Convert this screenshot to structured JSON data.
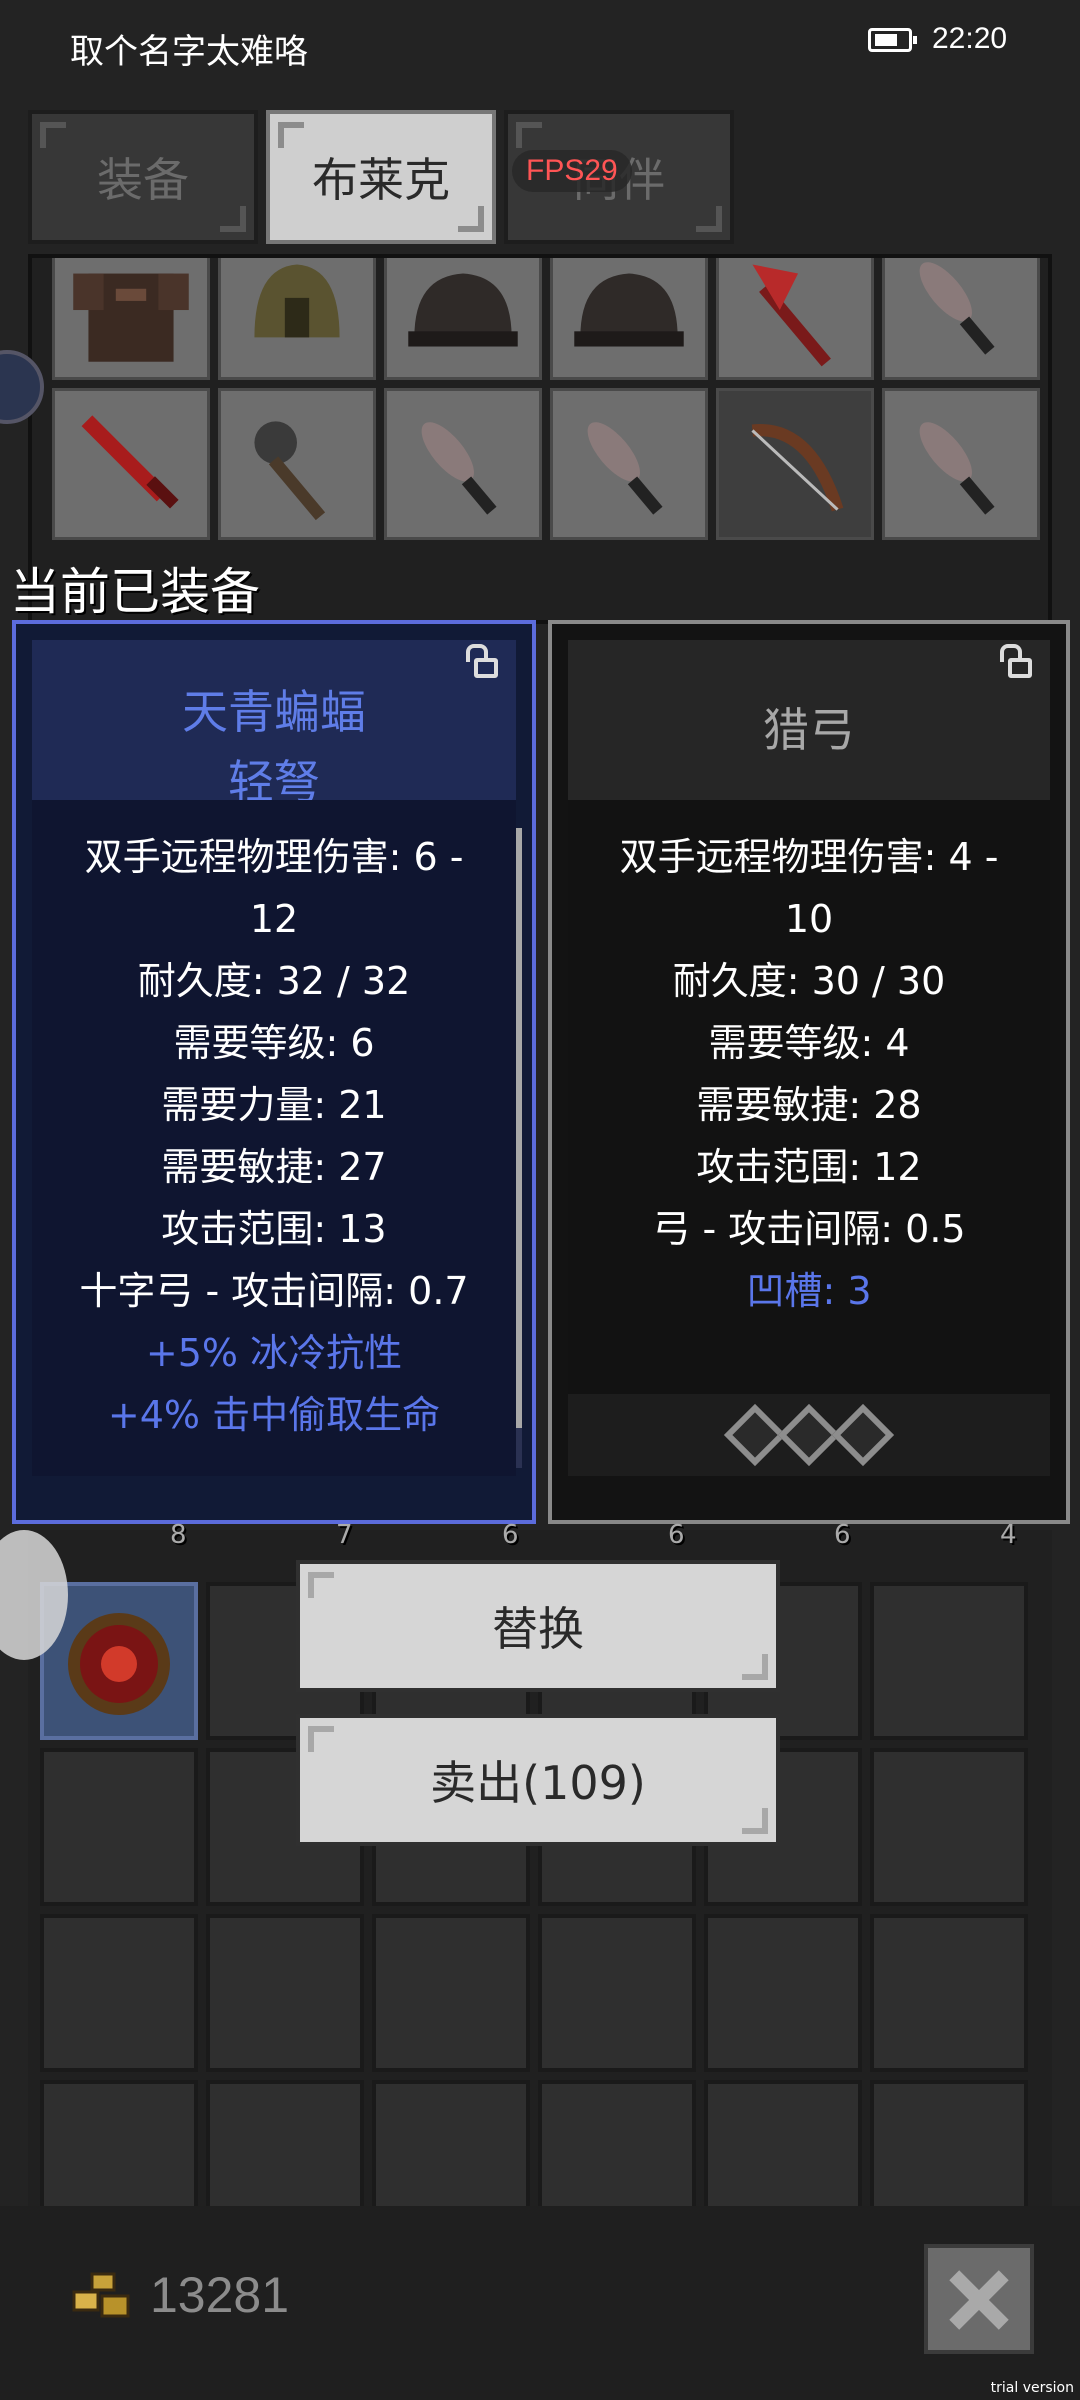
{
  "status_bar": {
    "title": "取个名字太难咯",
    "time": "22:20"
  },
  "tabs": [
    {
      "label": "装备",
      "active": false
    },
    {
      "label": "布莱克",
      "active": true
    },
    {
      "label": "同伴",
      "active": false
    }
  ],
  "fps": "FPS29",
  "equipped_label": "当前已装备",
  "left_item": {
    "name_line1": "天青蝙蝠",
    "name_line2": "轻弩",
    "stats": [
      "双手远程物理伤害: 6 -",
      "12",
      "耐久度: 32 / 32",
      "需要等级: 6",
      "需要力量: 21",
      "需要敏捷: 27",
      "攻击范围: 13",
      "十字弓 - 攻击间隔: 0.7"
    ],
    "bonuses": [
      "+5% 冰冷抗性",
      "+4% 击中偷取生命"
    ]
  },
  "right_item": {
    "name": "猎弓",
    "stats": [
      "双手远程物理伤害: 4 -",
      "10",
      "耐久度: 30 / 30",
      "需要等级: 4",
      "需要敏捷: 28",
      "攻击范围: 12",
      "弓 - 攻击间隔: 0.5"
    ],
    "sockets_label": "凹槽: 3",
    "socket_count": 3
  },
  "buttons": {
    "replace": "替换",
    "sell": "卖出(109)"
  },
  "slot_numbers": [
    "8",
    "7",
    "6",
    "6",
    "6",
    "4"
  ],
  "gold": "13281",
  "watermark": "trial version",
  "icons": {
    "inventory_items": [
      "armor-icon",
      "helmet-icon",
      "cap-icon",
      "cap-icon",
      "axe-icon",
      "dagger-icon",
      "sword-icon",
      "mace-icon",
      "dagger-icon",
      "dagger-icon",
      "bow-icon",
      "dagger-icon"
    ]
  },
  "colors": {
    "accent_blue": "#5a76ea",
    "panel_left_border": "#5c6cdc",
    "fps_red": "#ff5555"
  }
}
